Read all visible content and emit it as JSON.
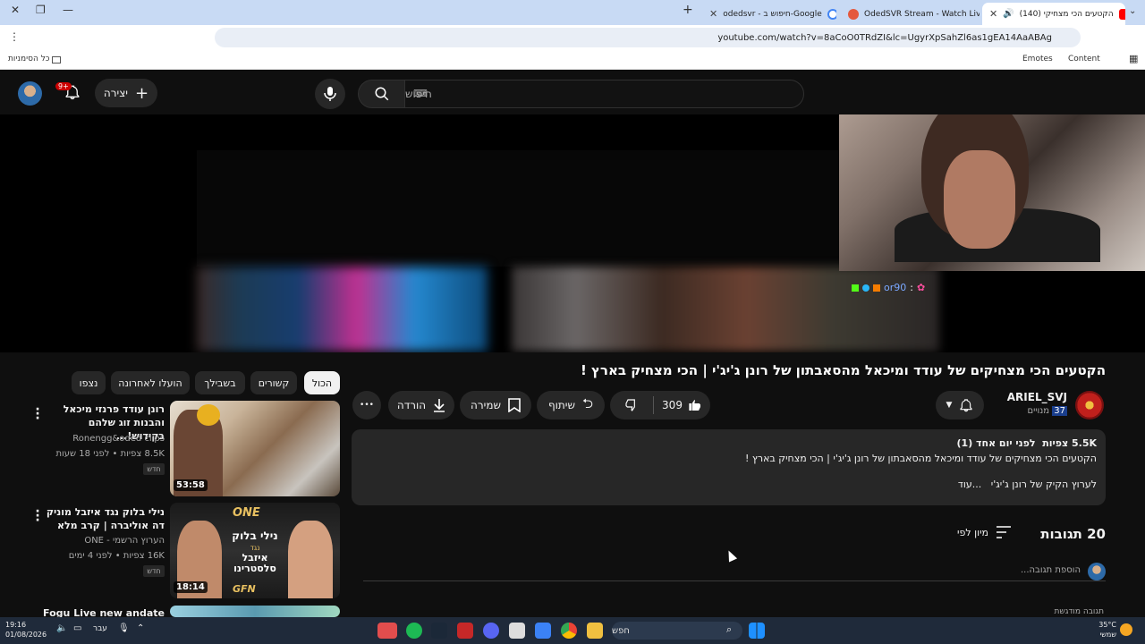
{
  "browser": {
    "tabs": [
      {
        "title": "(140) הקטעים הכי מצחיקי",
        "active": true
      },
      {
        "title": "OdedSVR Stream - Watch Live",
        "active": false
      },
      {
        "title": "odedsvr - חיפוש ב-Google",
        "active": false
      }
    ],
    "url": "youtube.com/watch?v=8aCoO0TRdZI&lc=UgyrXpSahZl6as1gEA14AaABAg",
    "bookmarks": {
      "all_bookmarks": "כל הסימניות",
      "content": "Content",
      "emotes": "Emotes"
    }
  },
  "yt_header": {
    "search_placeholder": "חיפוש",
    "create_label": "יצירה",
    "notifications_badge": "9+"
  },
  "stream_overlay": {
    "chat_user": "or90",
    "chat_separator": ":"
  },
  "video": {
    "title": "הקטעים הכי מצחיקים של עודד ומיכאל מהסאבתון של רונן ג'יג'י | הכי מצחיק בארץ !",
    "channel": "ARIEL_SVJ",
    "subscribers_count": "37",
    "subscribers_label": "מנויים",
    "likes": "309",
    "share_label": "שיתוף",
    "save_label": "שמירה",
    "download_label": "הורדה",
    "more_label": "•••"
  },
  "description": {
    "views": "5.5K צפיות",
    "age": "לפני יום אחד (1)",
    "text": "הקטעים הכי מצחיקים של עודד ומיכאל מהסאבתון של רונן ג'יג'י | הכי מצחיק בארץ !",
    "link_line": "לערוץ הקיק של רונן ג'יג'י",
    "more": "...עוד"
  },
  "comments": {
    "count_label": "20 תגובות",
    "sort_label": "מיון לפי",
    "add_placeholder": "הוספת תגובה...",
    "pinned_label": "תגובה מודגשת"
  },
  "chips": [
    "הכול",
    "קשורים",
    "בשבילך",
    "הועלו לאחרונה",
    "נצפו"
  ],
  "related": [
    {
      "title": "רונן עודד פרנזי מיכאל והבנות זוג שלהם בקידוש!...",
      "channel": "Ronengg&oded clips",
      "meta": "8.5K צפיות • לפני 18 שעות",
      "badge": "חדש",
      "duration": "53:58"
    },
    {
      "title": "נילי בלוק נגד איזבל מוניק דה אוליברה | קרב מלא",
      "channel": "הערוץ הרשמי - ONE",
      "meta": "16K צפיות • לפני 4 ימים",
      "badge": "חדש",
      "duration": "18:14",
      "thumb_text_top": "נילי בלוק",
      "thumb_text_bottom": "איזבל סלסטרינו",
      "thumb_vs": "נגד",
      "thumb_brand": "ONE",
      "thumb_brand_bottom": "GFN"
    },
    {
      "title": "Fogu Live new andate",
      "channel": "",
      "meta": "",
      "badge": "",
      "duration": ""
    }
  ],
  "taskbar": {
    "time": "19:16",
    "date": "01/08/2026",
    "lang": "עבר",
    "search_label": "חפש",
    "temperature": "35°C",
    "weather": "שמשי"
  }
}
